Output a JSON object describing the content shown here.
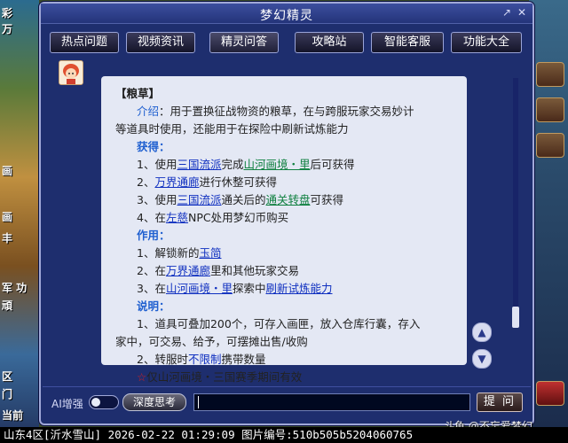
{
  "window": {
    "title": "梦幻精灵"
  },
  "tabs": [
    {
      "label": "热点问题"
    },
    {
      "label": "视频资讯"
    },
    {
      "label": "精灵问答"
    },
    {
      "label": "攻略站"
    },
    {
      "label": "智能客服"
    },
    {
      "label": "功能大全"
    }
  ],
  "content": {
    "heading": "【粮草】",
    "intro_label": "介绍",
    "intro_text_1": "：用于置换征战物资的粮草，在与跨服玩家交易妙计",
    "intro_text_2": "等道具时使用，还能用于在探险中刷新试炼能力",
    "obtain_label": "获得",
    "obtain": [
      {
        "pre": "1、使用",
        "link1": "三国流派",
        "mid": "完成",
        "link2": "山河画境・里",
        "post": "后可获得"
      },
      {
        "pre": "2、",
        "link1": "万界通廊",
        "post": "进行休整可获得"
      },
      {
        "pre": "3、使用",
        "link1": "三国流派",
        "mid": "通关后的",
        "link2": "通关转盘",
        "post": "可获得"
      },
      {
        "pre": "4、在",
        "link1": "左慈",
        "post": "NPC处用梦幻币购买"
      }
    ],
    "use_label": "作用",
    "uses": [
      {
        "pre": "1、解锁新的",
        "link1": "玉简"
      },
      {
        "pre": "2、在",
        "link1": "万界通廊",
        "post": "里和其他玩家交易"
      },
      {
        "pre": "3、在",
        "link1": "山河画境・里",
        "mid": "探索中",
        "link2": "刷新试炼能力"
      }
    ],
    "note_label": "说明",
    "note_1a": "1、道具可叠加200个，可存入画匣，放入仓库行囊，存入",
    "note_1b": "家中，可交易、给予，可摆摊出售/收购",
    "note_2_pre": "2、转服时",
    "note_2_hl": "不限制",
    "note_2_post": "携带数量",
    "note_star": "☆",
    "note_3": "仅山河画境・三国赛季期间有效"
  },
  "bottom": {
    "ai_label": "AI增强",
    "think_label": "深度思考",
    "ask_label": "提 问"
  },
  "status_bar": "山东4区[沂水雪山] 2026-02-22 01:29:09 图片编号:510b505b5204060765",
  "watermark": "斗鱼 @不忘爱梦幻",
  "background": {
    "left_labels": [
      "彩",
      "万",
      "画",
      "画",
      "丰",
      "军 功",
      "頑",
      "区",
      "门",
      "当前"
    ]
  }
}
